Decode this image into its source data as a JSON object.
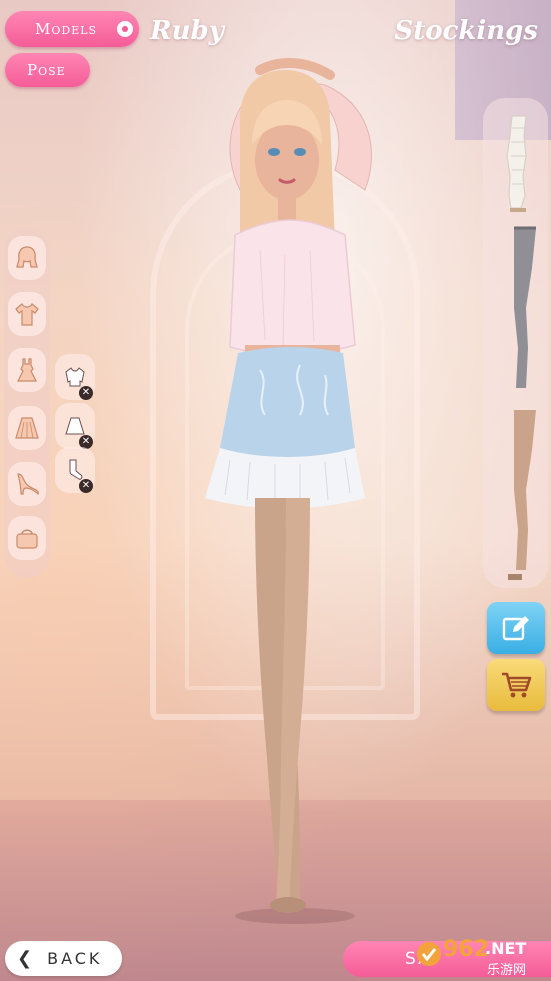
{
  "header": {
    "models_label": "Models",
    "pose_label": "Pose",
    "model_name": "Ruby",
    "category_title": "Stockings"
  },
  "categories": [
    {
      "name": "hair",
      "icon": "hair-icon"
    },
    {
      "name": "tops",
      "icon": "shirt-icon"
    },
    {
      "name": "dresses",
      "icon": "dress-icon"
    },
    {
      "name": "skirts",
      "icon": "skirt-icon"
    },
    {
      "name": "shoes",
      "icon": "heel-shoe-icon"
    },
    {
      "name": "bags",
      "icon": "bag-icon"
    }
  ],
  "worn_items": [
    {
      "name": "top",
      "icon": "sweater-icon"
    },
    {
      "name": "skirt",
      "icon": "skirt-icon"
    },
    {
      "name": "stockings",
      "icon": "sock-icon"
    }
  ],
  "stocking_items": [
    {
      "name": "white-leg-warmers",
      "color": "#f4f1ea"
    },
    {
      "name": "grey-tights",
      "color": "#8f8f95"
    },
    {
      "name": "nude-tights",
      "color": "#c9a48a"
    }
  ],
  "actions": {
    "edit_icon": "edit-icon",
    "cart_icon": "cart-icon"
  },
  "footer": {
    "back_label": "BACK",
    "save_label": "SA"
  },
  "watermark": {
    "text_main": "962",
    "text_net": ".NET",
    "text_cn": "乐游网"
  },
  "colors": {
    "accent_pink": "#f55c97",
    "edit_blue": "#3aaee4",
    "cart_yellow": "#e8bb3c"
  }
}
